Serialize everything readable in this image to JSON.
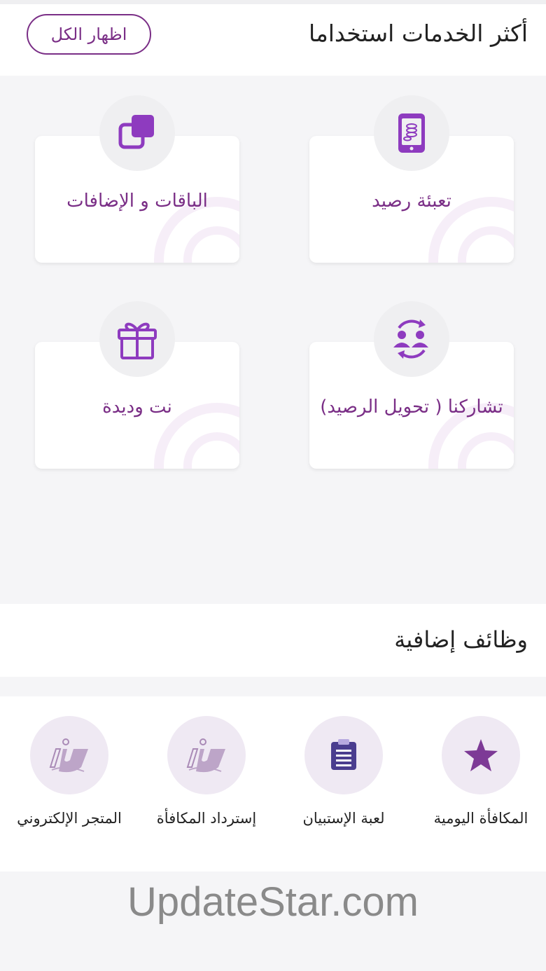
{
  "header": {
    "title": "أكثر الخدمات استخداما",
    "show_all_label": "اظهار الكل"
  },
  "services": [
    {
      "label": "تعبئة رصيد",
      "icon": "mobile-coins-icon"
    },
    {
      "label": "الباقات و الإضافات",
      "icon": "layers-icon"
    },
    {
      "label": "تشاركنا ( تحويل الرصيد)",
      "icon": "users-transfer-icon"
    },
    {
      "label": "نت وديدة",
      "icon": "gift-icon"
    }
  ],
  "extras_section": {
    "title": "وظائف إضافية",
    "items": [
      {
        "label": "المكافأة اليومية",
        "icon": "star-icon"
      },
      {
        "label": "لعبة الإستبيان",
        "icon": "clipboard-icon"
      },
      {
        "label": "إسترداد المكافأة",
        "icon": "brand-logo-icon"
      },
      {
        "label": "المتجر الإلكتروني",
        "icon": "brand-logo-icon"
      }
    ]
  },
  "watermark": "UpdateStar.com",
  "colors": {
    "accent": "#7a2e86",
    "icon_purple": "#8e3bbf",
    "background": "#f5f5f7"
  }
}
